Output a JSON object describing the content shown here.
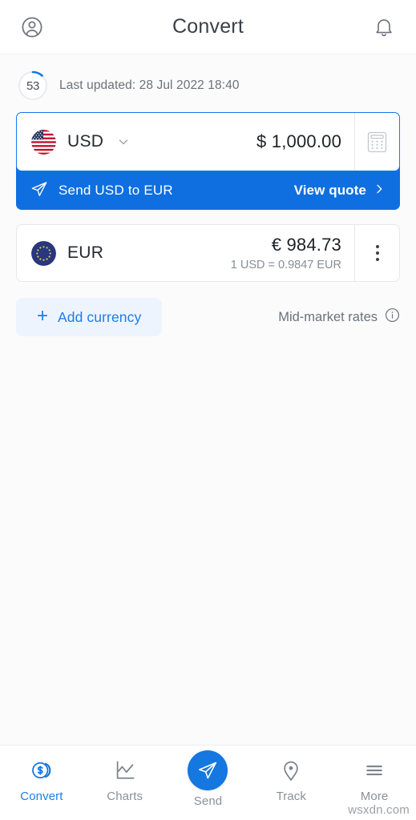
{
  "header": {
    "title": "Convert",
    "profile_icon": "account-circle-icon",
    "notification_icon": "bell-icon"
  },
  "status": {
    "countdown_value": "53",
    "last_updated": "Last updated: 28 Jul 2022 18:40"
  },
  "source_currency": {
    "code": "USD",
    "flag": "us-flag-icon",
    "amount": "$ 1,000.00",
    "action_icon": "calculator-icon",
    "chevron_icon": "chevron-down-icon"
  },
  "send_banner": {
    "icon": "send-plane-icon",
    "label": "Send USD to EUR",
    "cta": "View quote",
    "cta_icon": "chevron-right-icon"
  },
  "target_currency": {
    "code": "EUR",
    "flag": "eu-flag-icon",
    "amount": "€ 984.73",
    "rate": "1 USD = 0.9847 EUR",
    "action_icon": "more-vertical-icon"
  },
  "actions": {
    "add_currency": "Add currency",
    "add_icon": "plus-icon",
    "mid_market": "Mid-market rates",
    "info_icon": "info-circle-icon"
  },
  "bottom_nav": [
    {
      "label": "Convert",
      "icon": "coins-dollar-icon",
      "active": true
    },
    {
      "label": "Charts",
      "icon": "line-chart-icon",
      "active": false
    },
    {
      "label": "Send",
      "icon": "send-plane-icon",
      "active": false
    },
    {
      "label": "Track",
      "icon": "map-pin-icon",
      "active": false
    },
    {
      "label": "More",
      "icon": "hamburger-menu-icon",
      "active": false
    }
  ],
  "watermark": "wsxdn.com",
  "colors": {
    "accent": "#1577e0",
    "banner": "#0f6fe0",
    "muted": "#6b727b",
    "card_border": "#e6e8ec"
  }
}
